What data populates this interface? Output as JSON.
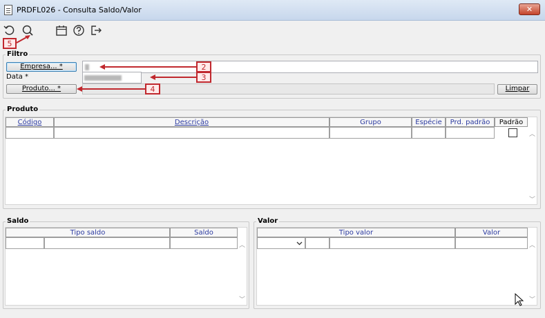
{
  "window": {
    "title": "PRDFL026 - Consulta Saldo/Valor",
    "close_label": "✕"
  },
  "toolbar": {
    "undo_icon": "undo-icon",
    "search_icon": "search-icon",
    "calendar_icon": "calendar-icon",
    "help_icon": "help-icon",
    "exit_icon": "exit-icon"
  },
  "annotations": {
    "a5": "5",
    "a2": "2",
    "a3": "3",
    "a4": "4",
    "color": "#c0282e"
  },
  "filtro": {
    "legend": "Filtro",
    "empresa_button": "Empresa... *",
    "data_label": "Data *",
    "produto_button": "Produto... *",
    "limpar_button": "Limpar"
  },
  "produto": {
    "legend": "Produto",
    "columns": [
      "Código",
      "Descrição",
      "Grupo",
      "Espécie",
      "Prd. padrão",
      "Padrão"
    ]
  },
  "saldo": {
    "legend": "Saldo",
    "columns": [
      "Tipo saldo",
      "Saldo"
    ]
  },
  "valor": {
    "legend": "Valor",
    "columns": [
      "Tipo valor",
      "Valor"
    ]
  }
}
